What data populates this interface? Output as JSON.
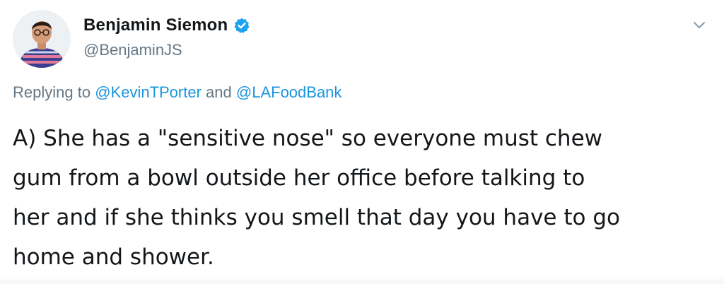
{
  "author": {
    "display_name": "Benjamin Siemon",
    "handle": "@BenjaminJS",
    "verified": true
  },
  "reply": {
    "prefix": "Replying to",
    "mention_1": "@KevinTPorter",
    "joiner": "and",
    "mention_2": "@LAFoodBank"
  },
  "tweet": {
    "lines": [
      "A) She has a \"sensitive nose\" so everyone must chew",
      "gum from a bowl outside her office before talking to",
      "her and if she thinks you smell that day you have to go",
      "home and shower."
    ]
  },
  "icons": {
    "verified": "verified-badge-icon",
    "menu": "chevron-down-icon"
  },
  "colors": {
    "text": "#14171a",
    "muted": "#657786",
    "link": "#1b95e0",
    "verified": "#1da1f2"
  }
}
